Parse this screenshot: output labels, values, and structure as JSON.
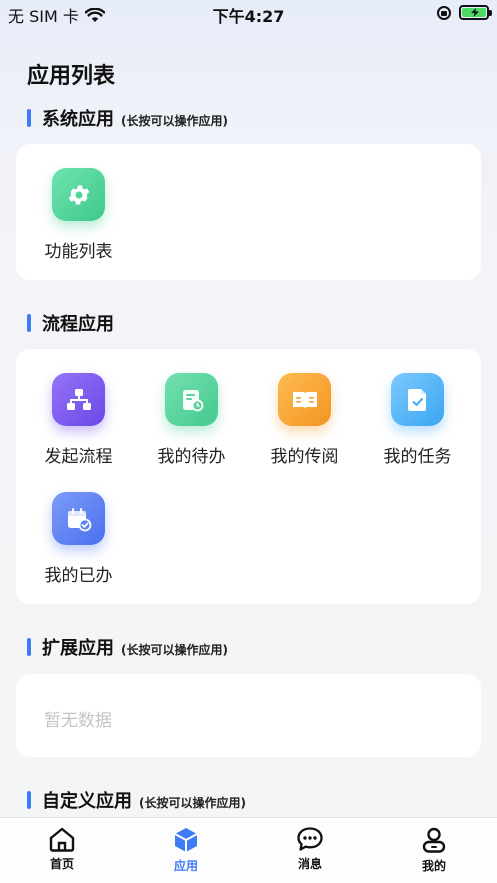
{
  "status_bar": {
    "carrier": "无 SIM 卡",
    "time": "下午4:27",
    "battery_color": "#4cd964"
  },
  "page": {
    "title": "应用列表"
  },
  "sections": {
    "system": {
      "title": "系统应用",
      "hint": "(长按可以操作应用)",
      "apps": [
        {
          "label": "功能列表",
          "icon": "gear-icon",
          "color": "#4fd69a"
        }
      ]
    },
    "process": {
      "title": "流程应用",
      "apps": [
        {
          "label": "发起流程",
          "icon": "flowchart-icon",
          "color": "#7b5cf0"
        },
        {
          "label": "我的待办",
          "icon": "todo-doc-icon",
          "color": "#56d39c"
        },
        {
          "label": "我的传阅",
          "icon": "open-book-icon",
          "color": "#f7a23a"
        },
        {
          "label": "我的任务",
          "icon": "task-file-icon",
          "color": "#4db3f7"
        },
        {
          "label": "我的已办",
          "icon": "calendar-check-icon",
          "color": "#5a82f2"
        }
      ]
    },
    "extension": {
      "title": "扩展应用",
      "hint": "(长按可以操作应用)",
      "empty_text": "暂无数据"
    },
    "custom": {
      "title": "自定义应用",
      "hint": "(长按可以操作应用)"
    }
  },
  "tab_bar": {
    "active_color": "#3e7cf6",
    "tabs": [
      {
        "label": "首页",
        "icon": "home-icon"
      },
      {
        "label": "应用",
        "icon": "cube-icon",
        "active": true
      },
      {
        "label": "消息",
        "icon": "chat-bubble-icon"
      },
      {
        "label": "我的",
        "icon": "profile-icon"
      }
    ]
  }
}
